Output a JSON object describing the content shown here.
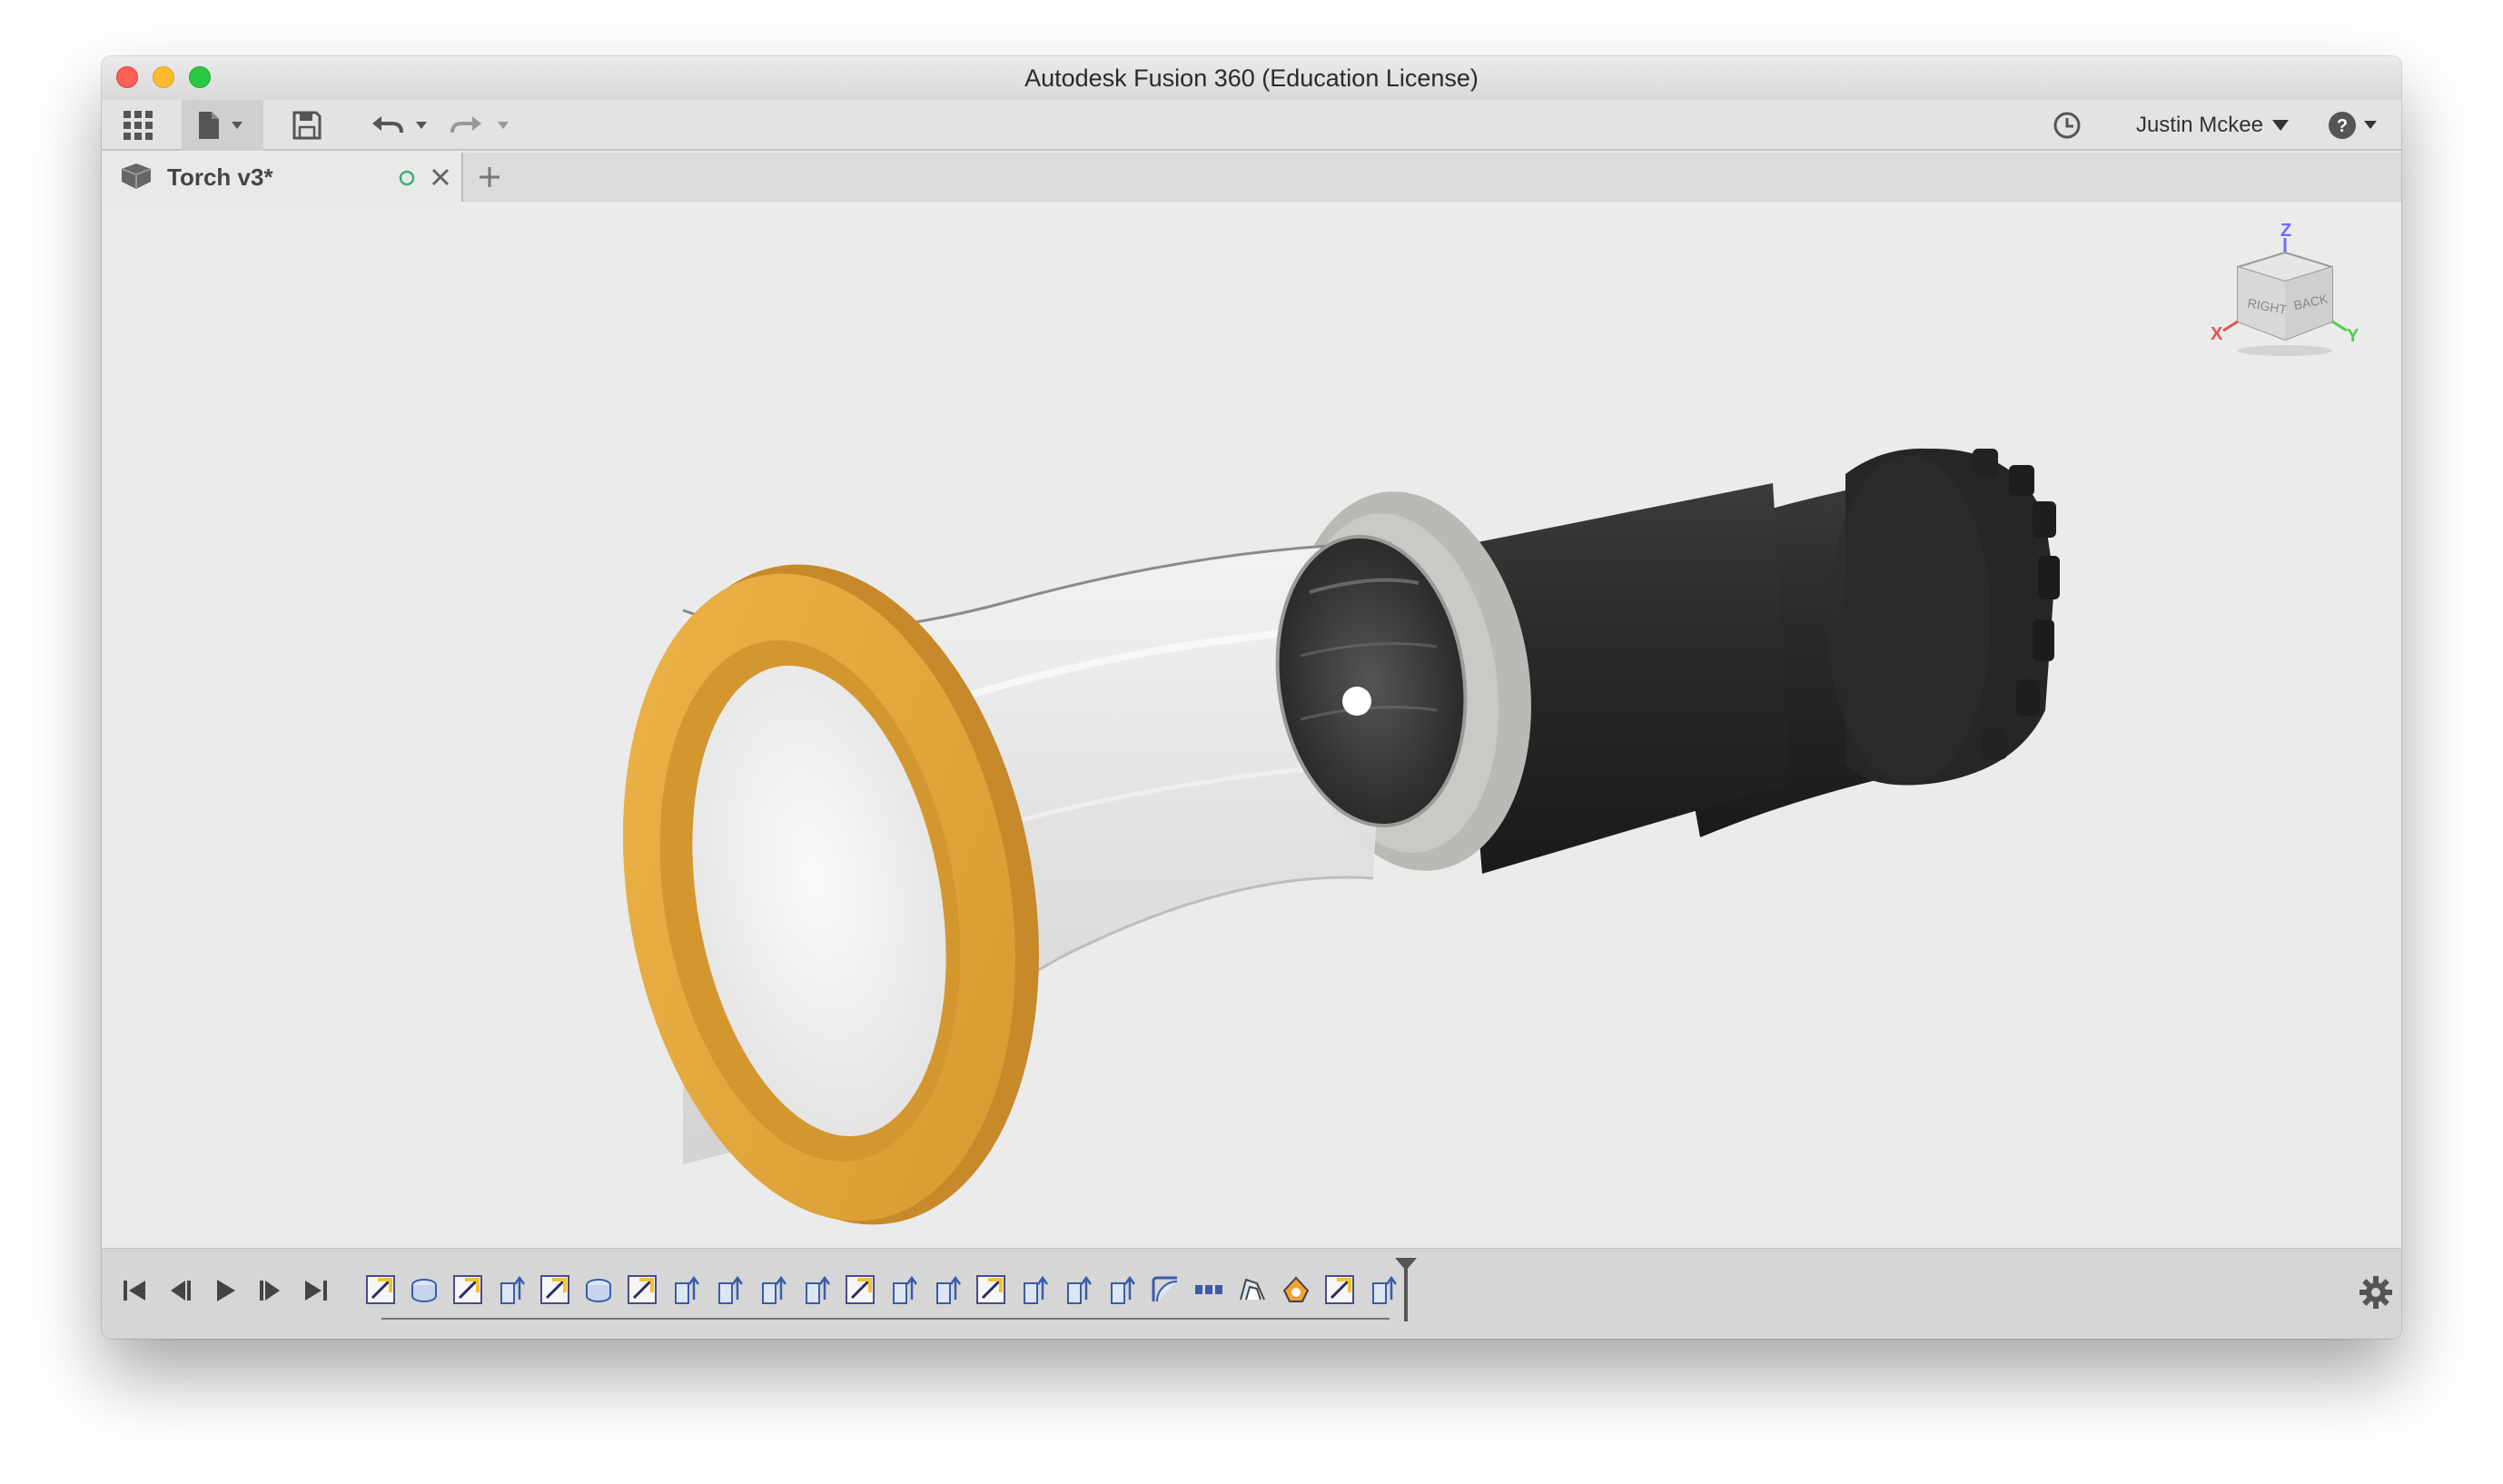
{
  "window": {
    "title": "Autodesk Fusion 360 (Education License)"
  },
  "toolbar": {
    "user_name": "Justin Mckee"
  },
  "document_tab": {
    "title": "Torch v3*"
  },
  "colors": {
    "bezel": "#e5a73e",
    "body_dark": "#2b2b2b",
    "glass": "#d9d9d9",
    "accent_yellow": "#f2c12e",
    "viewcube_z": "#6b6bff",
    "viewcube_x": "#e65050",
    "viewcube_y": "#4ad04a"
  },
  "viewcube": {
    "axis_z": "Z",
    "axis_x": "X",
    "axis_y": "Y",
    "face_right": "RIGHT",
    "face_back": "BACK"
  },
  "timeline": {
    "features": [
      "sketch",
      "revolve",
      "sketch",
      "extrude",
      "sketch",
      "revolve",
      "sketch",
      "extrude",
      "extrude",
      "extrude",
      "extrude",
      "sketch",
      "extrude",
      "extrude",
      "sketch",
      "extrude",
      "extrude",
      "extrude",
      "fillet",
      "pattern",
      "shell",
      "appearance",
      "sketch",
      "extrude"
    ]
  }
}
